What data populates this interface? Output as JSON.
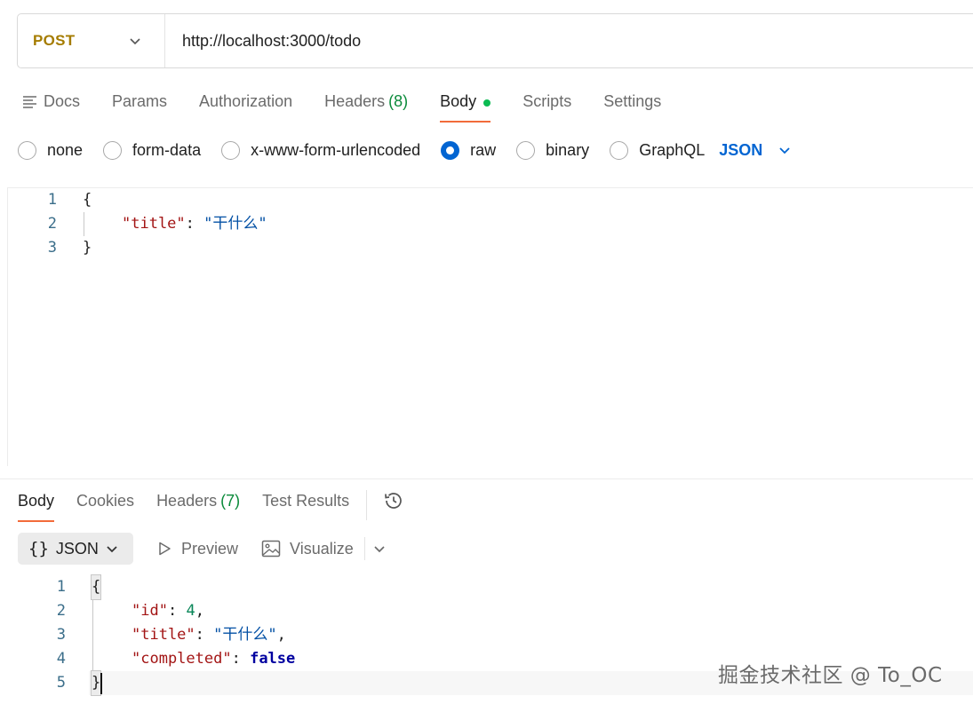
{
  "request": {
    "method": "POST",
    "url": "http://localhost:3000/todo"
  },
  "request_tabs": {
    "docs": "Docs",
    "params": "Params",
    "authorization": "Authorization",
    "headers": "Headers",
    "headers_count": "(8)",
    "body": "Body",
    "scripts": "Scripts",
    "settings": "Settings"
  },
  "body_types": {
    "none": "none",
    "form_data": "form-data",
    "urlencoded": "x-www-form-urlencoded",
    "raw": "raw",
    "binary": "binary",
    "graphql": "GraphQL",
    "selected": "raw",
    "language": "JSON"
  },
  "request_body": {
    "line_numbers": [
      "1",
      "2",
      "3"
    ],
    "open_brace": "{",
    "key_title": "\"title\"",
    "colon": ": ",
    "value_title": "\"干什么\"",
    "close_brace": "}"
  },
  "response_tabs": {
    "body": "Body",
    "cookies": "Cookies",
    "headers": "Headers",
    "headers_count": "(7)",
    "test_results": "Test Results"
  },
  "response_toolbar": {
    "format_braces": "{}",
    "format": "JSON",
    "preview": "Preview",
    "visualize": "Visualize"
  },
  "response_body": {
    "line_numbers": [
      "1",
      "2",
      "3",
      "4",
      "5"
    ],
    "open_brace": "{",
    "key_id": "\"id\"",
    "value_id": "4",
    "key_title": "\"title\"",
    "value_title": "\"干什么\"",
    "key_completed": "\"completed\"",
    "value_completed": "false",
    "colon": ": ",
    "comma": ",",
    "close_brace": "}"
  },
  "watermark": "掘金技术社区 @ To_OC",
  "colors": {
    "method": "#a57c00",
    "accent_tab": "#f26b3a",
    "selected_radio": "#0265d2",
    "count_green": "#0a8a3a",
    "body_dot": "#0cbb52"
  }
}
